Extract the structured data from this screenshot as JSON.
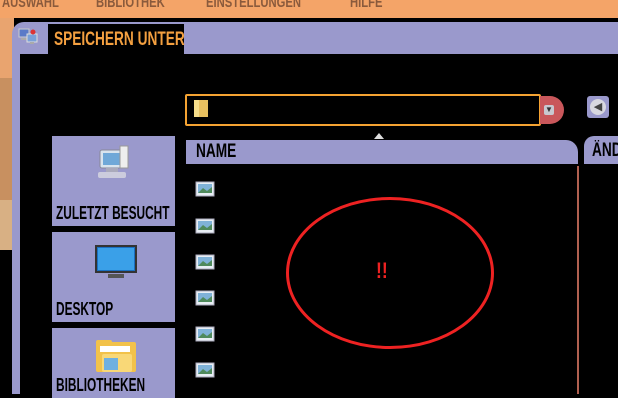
{
  "menubar": {
    "items": [
      "Auswahl",
      "Bibliothek",
      "Einstellungen",
      "Hilfe"
    ]
  },
  "dialog": {
    "title": "SPEICHERN UNTER"
  },
  "path": {
    "value": ""
  },
  "columns": {
    "name": "NAME",
    "changed": "ÄND"
  },
  "sidebar": {
    "items": [
      {
        "label": "ZULETZT BESUCHT",
        "icon": "recent-places-icon"
      },
      {
        "label": "DESKTOP",
        "icon": "desktop-icon"
      },
      {
        "label": "BIBLIOTHEKEN",
        "icon": "libraries-folder-icon"
      }
    ]
  },
  "files": [
    {
      "icon": "image-file-icon"
    },
    {
      "icon": "image-file-icon"
    },
    {
      "icon": "image-file-icon"
    },
    {
      "icon": "image-file-icon"
    },
    {
      "icon": "image-file-icon"
    },
    {
      "icon": "image-file-icon"
    }
  ],
  "annotation": {
    "text": "!!",
    "color": "#ee2222"
  },
  "colors": {
    "lavender": "#9a99cc",
    "orange": "#f5a332",
    "title_text": "#f4a040"
  }
}
